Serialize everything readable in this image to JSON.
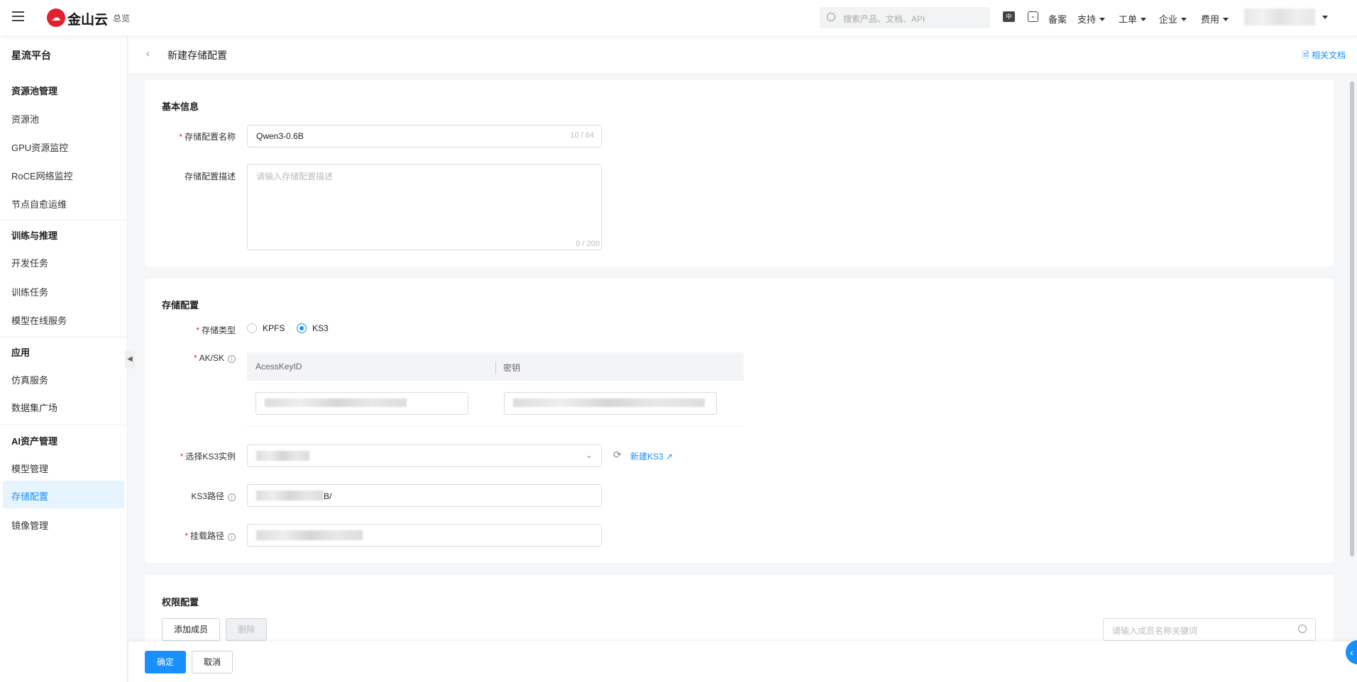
{
  "header": {
    "logo_text": "金山云",
    "overview": "总览",
    "search_placeholder": "搜索产品、文档、API",
    "lang_icon": "中",
    "nav": [
      "备案",
      "支持",
      "工单",
      "企业",
      "费用"
    ]
  },
  "sidebar": {
    "title": "星流平台",
    "groups": [
      {
        "label": "资源池管理",
        "items": [
          "资源池",
          "GPU资源监控",
          "RoCE网络监控",
          "节点自愈运维"
        ]
      },
      {
        "label": "训练与推理",
        "items": [
          "开发任务",
          "训练任务",
          "模型在线服务"
        ]
      },
      {
        "label": "应用",
        "items": [
          "仿真服务",
          "数据集广场"
        ]
      },
      {
        "label": "AI资产管理",
        "items": [
          "模型管理",
          "存储配置",
          "镜像管理"
        ]
      }
    ],
    "active": "存储配置"
  },
  "page": {
    "title": "新建存储配置",
    "docs_link": "相关文档"
  },
  "basic": {
    "title": "基本信息",
    "name_label": "存储配置名称",
    "name_value": "Qwen3-0.6B",
    "name_count": "10 / 64",
    "desc_label": "存储配置描述",
    "desc_placeholder": "请输入存储配置描述",
    "desc_count": "0 / 200"
  },
  "storage": {
    "title": "存储配置",
    "type_label": "存储类型",
    "types": [
      "KPFS",
      "KS3"
    ],
    "selected_type": "KS3",
    "aksk_label": "AK/SK",
    "col_ak": "AcessKeyID",
    "col_sk": "密钥",
    "instance_label": "选择KS3实例",
    "new_ks3": "新建KS3",
    "path_label": "KS3路径",
    "path_value_suffix": "B/",
    "mount_label": "挂载路径"
  },
  "permission": {
    "title": "权限配置",
    "add_member": "添加成员",
    "delete": "删除",
    "search_placeholder": "请输入成员名称关键词"
  },
  "footer": {
    "confirm": "确定",
    "cancel": "取消"
  }
}
